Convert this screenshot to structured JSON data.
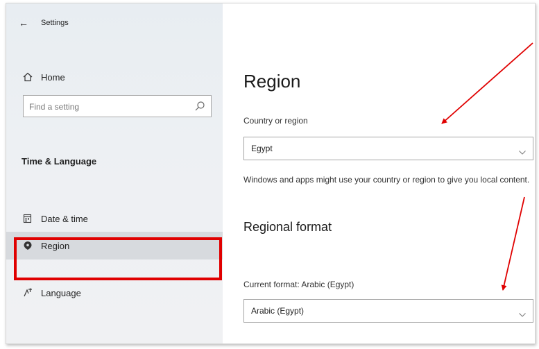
{
  "window": {
    "title": "Settings"
  },
  "sidebar": {
    "home_label": "Home",
    "search_placeholder": "Find a setting",
    "section_heading": "Time & Language",
    "items": [
      {
        "label": "Date & time",
        "icon": "calendar-clock-icon"
      },
      {
        "label": "Region",
        "icon": "globe-icon",
        "selected": true
      },
      {
        "label": "Language",
        "icon": "language-icon"
      }
    ]
  },
  "main": {
    "title": "Region",
    "country": {
      "label": "Country or region",
      "value": "Egypt",
      "description": "Windows and apps might use your country or region to give you local content."
    },
    "regional_format": {
      "heading": "Regional format",
      "current_label": "Current format: Arabic (Egypt)",
      "value": "Arabic (Egypt)"
    }
  },
  "annotation_colors": {
    "highlight": "#e00000",
    "arrow": "#e00000"
  }
}
